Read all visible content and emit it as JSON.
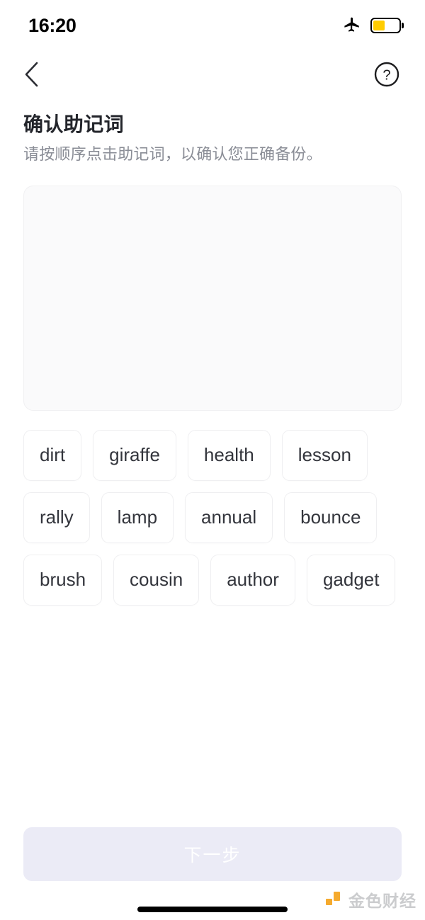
{
  "status_bar": {
    "time": "16:20",
    "airplane_icon": "airplane-mode-icon",
    "battery_icon": "battery-icon",
    "battery_level_percent": 45,
    "battery_color": "#FFCC00"
  },
  "nav": {
    "back_icon": "chevron-left-icon",
    "help_icon": "question-circle-icon"
  },
  "header": {
    "title": "确认助记词",
    "subtitle": "请按顺序点击助记词，以确认您正确备份。"
  },
  "answer_area": {
    "selected_words": [],
    "placeholder": ""
  },
  "word_pool": {
    "words": [
      "dirt",
      "giraffe",
      "health",
      "lesson",
      "rally",
      "lamp",
      "annual",
      "bounce",
      "brush",
      "cousin",
      "author",
      "gadget"
    ]
  },
  "footer": {
    "next_label": "下一步",
    "next_enabled": false,
    "next_bg_color": "#EBEBF6"
  },
  "watermark": {
    "text": "金色财经",
    "logo_color": "#F5A623"
  },
  "theme": {
    "background": "#FFFFFF",
    "title_color": "#23252B",
    "subtitle_color": "#8A8D96",
    "chip_border": "#EFEFF1",
    "answer_bg": "#FAFAFB"
  }
}
